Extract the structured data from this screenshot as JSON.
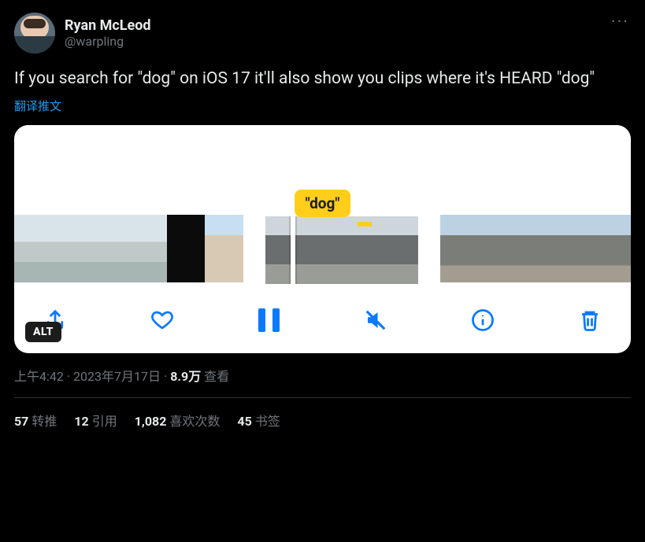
{
  "author": {
    "display_name": "Ryan McLeod",
    "handle": "@warpling"
  },
  "tweet_text": "If you search for \"dog\" on iOS 17 it'll also show you clips where it's HEARD \"dog\"",
  "translate_label": "翻译推文",
  "media": {
    "caption_badge": "\"dog\"",
    "alt_badge": "ALT",
    "controls": {
      "share": "share-icon",
      "like": "heart-icon",
      "pause": "pause-icon",
      "mute": "speaker-muted-icon",
      "info": "info-icon",
      "trash": "trash-icon"
    }
  },
  "meta": {
    "time": "上午4:42",
    "date": "2023年7月17日",
    "views_value": "8.9万",
    "views_label": "查看"
  },
  "stats": {
    "retweets": {
      "count": "57",
      "label": "转推"
    },
    "quotes": {
      "count": "12",
      "label": "引用"
    },
    "likes": {
      "count": "1,082",
      "label": "喜欢次数"
    },
    "bookmarks": {
      "count": "45",
      "label": "书签"
    }
  },
  "more_label": "···"
}
